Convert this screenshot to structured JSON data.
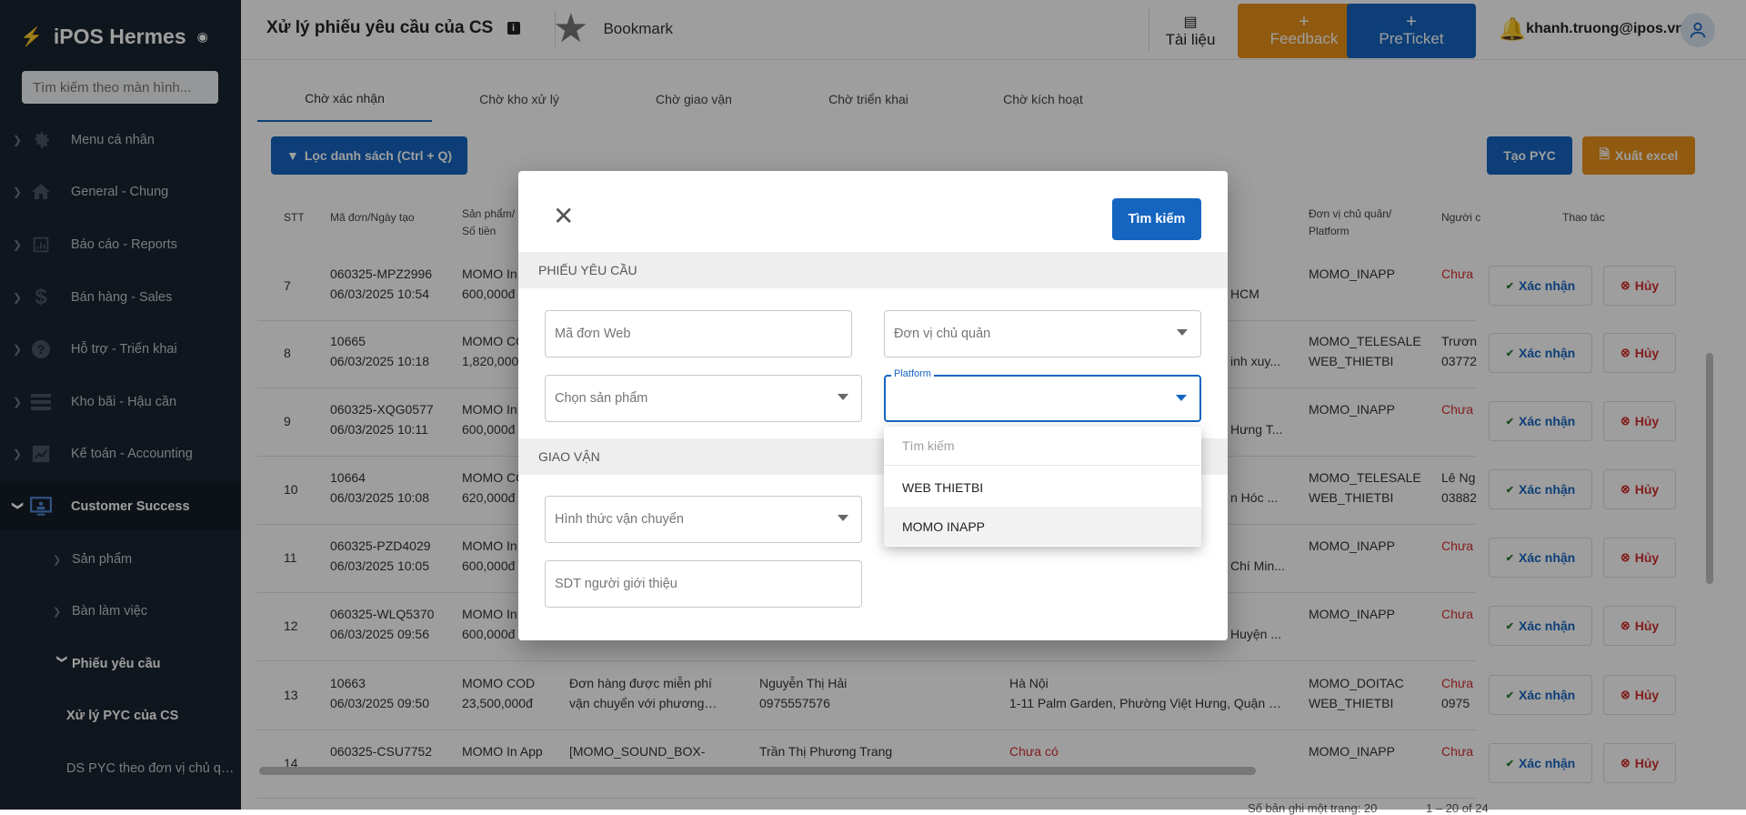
{
  "app": {
    "name": "iPOS Hermes",
    "search_placeholder": "Tìm kiếm theo màn hình..."
  },
  "sidebar": {
    "items": [
      {
        "label": "Menu cá nhân",
        "icon": "gear-icon"
      },
      {
        "label": "General - Chung",
        "icon": "home-icon"
      },
      {
        "label": "Báo cáo - Reports",
        "icon": "bar-chart-icon"
      },
      {
        "label": "Bán hàng - Sales",
        "icon": "dollar-icon"
      },
      {
        "label": "Hỗ trợ - Triển khai",
        "icon": "help-icon"
      },
      {
        "label": "Kho bãi - Hậu cần",
        "icon": "list-icon"
      },
      {
        "label": "Kế toán - Accounting",
        "icon": "chart-box-icon"
      },
      {
        "label": "Customer Success",
        "icon": "monitor-icon"
      }
    ],
    "sub_items": [
      {
        "label": "Sản phẩm"
      },
      {
        "label": "Bàn làm việc"
      },
      {
        "label": "Phiếu yêu cầu"
      },
      {
        "label": "Xử lý PYC của CS"
      },
      {
        "label": "DS PYC theo đơn vị chủ quản"
      }
    ]
  },
  "header": {
    "title": "Xử lý phiếu yêu cầu của CS",
    "bookmark": "Bookmark",
    "docs": "Tài liệu",
    "feedback": "Feedback",
    "preticket": "PreTicket",
    "user_email": "khanh.truong@ipos.vn",
    "plus": "+"
  },
  "tabs": [
    "Chờ xác nhận",
    "Chờ kho xử lý",
    "Chờ giao vận",
    "Chờ triển khai",
    "Chờ kích hoạt"
  ],
  "toolbar": {
    "filter": "Lọc danh sách (Ctrl + Q)",
    "create": "Tạo PYC",
    "export": "Xuất excel"
  },
  "table": {
    "headers": {
      "stt": "STT",
      "code": "Mã đơn/Ngày tạo",
      "product_1": "Sản phẩm/",
      "product_2": "Số tiền",
      "unit_1": "Đơn vị chủ quản/",
      "unit_2": "Platform",
      "person": "Người c",
      "action": "Thao tác"
    },
    "confirm_label": "Xác nhận",
    "cancel_label": "Hủy",
    "rows": [
      {
        "stt": "7",
        "code": "060325-MPZ2996",
        "date": "06/03/2025 10:54",
        "product": "MOMO In",
        "amount": "600,000đ",
        "note1": "",
        "note2": "",
        "customer": "",
        "phone": "",
        "addr1": "",
        "addr2": "HCM",
        "unit1": "MOMO_INAPP",
        "unit2": "",
        "person1": "Chưa",
        "person2": ""
      },
      {
        "stt": "8",
        "code": "10665",
        "date": "06/03/2025 10:18",
        "product": "MOMO CO",
        "amount": "1,820,000",
        "note1": "",
        "note2": "",
        "customer": "",
        "phone": "",
        "addr1": "",
        "addr2": "inh xuy...",
        "unit1": "MOMO_TELESALE",
        "unit2": "WEB_THIETBI",
        "person1": "Trươn",
        "person2": "03772"
      },
      {
        "stt": "9",
        "code": "060325-XQG0577",
        "date": "06/03/2025 10:11",
        "product": "MOMO In",
        "amount": "600,000đ",
        "note1": "",
        "note2": "",
        "customer": "",
        "phone": "",
        "addr1": "",
        "addr2": "Hưng T...",
        "unit1": "MOMO_INAPP",
        "unit2": "",
        "person1": "Chưa",
        "person2": ""
      },
      {
        "stt": "10",
        "code": "10664",
        "date": "06/03/2025 10:08",
        "product": "MOMO CO",
        "amount": "620,000đ",
        "note1": "",
        "note2": "",
        "customer": "",
        "phone": "",
        "addr1": "",
        "addr2": "n Hóc ...",
        "unit1": "MOMO_TELESALE",
        "unit2": "WEB_THIETBI",
        "person1": "Lê Ng",
        "person2": "03882"
      },
      {
        "stt": "11",
        "code": "060325-PZD4029",
        "date": "06/03/2025 10:05",
        "product": "MOMO In",
        "amount": "600,000đ",
        "note1": "",
        "note2": "",
        "customer": "",
        "phone": "",
        "addr1": "",
        "addr2": "Chí Min...",
        "unit1": "MOMO_INAPP",
        "unit2": "",
        "person1": "Chưa",
        "person2": ""
      },
      {
        "stt": "12",
        "code": "060325-WLQ5370",
        "date": "06/03/2025 09:56",
        "product": "MOMO In",
        "amount": "600,000đ",
        "note1": "",
        "note2": "",
        "customer": "",
        "phone": "",
        "addr1": "",
        "addr2": "Huyện ...",
        "unit1": "MOMO_INAPP",
        "unit2": "",
        "person1": "Chưa",
        "person2": ""
      },
      {
        "stt": "13",
        "code": "10663",
        "date": "06/03/2025 09:50",
        "product": "MOMO COD",
        "amount": "23,500,000đ",
        "note1": "Đơn hàng được miễn phí",
        "note2": "vận chuyển với phương th...",
        "customer": "Nguyễn Thị Hải",
        "phone": "0975557576",
        "addr1": "Hà Nội",
        "addr2": "1-11 Palm Garden, Phường Việt Hưng, Quận L...",
        "unit1": "MOMO_DOITAC",
        "unit2": "WEB_THIETBI",
        "person1": "Chưa",
        "person2": "0975"
      },
      {
        "stt": "14",
        "code": "060325-CSU7752",
        "date": "",
        "product": "MOMO In App",
        "amount": "",
        "note1": "[MOMO_SOUND_BOX-",
        "note2": "",
        "customer": "Trần Thị Phương Trang",
        "phone": "",
        "addr1": "Chưa có",
        "addr2": "",
        "unit1": "MOMO_INAPP",
        "unit2": "",
        "person1": "Chưa",
        "person2": ""
      }
    ]
  },
  "footer": {
    "rows_per_page": "Số bản ghi một trang: 20",
    "range": "1 – 20 of 24"
  },
  "modal": {
    "search_button": "Tìm kiếm",
    "section1": "PHIẾU YÊU CẦU",
    "section2": "GIAO VẬN",
    "fields": {
      "web_code": "Mã đơn Web",
      "unit": "Đơn vị chủ quản",
      "product": "Chọn sản phẩm",
      "platform_label": "Platform",
      "shipping": "Hình thức vận chuyển",
      "referrer_phone": "SDT người giới thiệu"
    },
    "dropdown": {
      "search_placeholder": "Tìm kiếm",
      "options": [
        "WEB THIETBI",
        "MOMO INAPP"
      ]
    }
  },
  "colors": {
    "primary": "#1565c0",
    "orange": "#e8911a",
    "sidebar": "#1b2430",
    "danger": "#d32f2f"
  }
}
